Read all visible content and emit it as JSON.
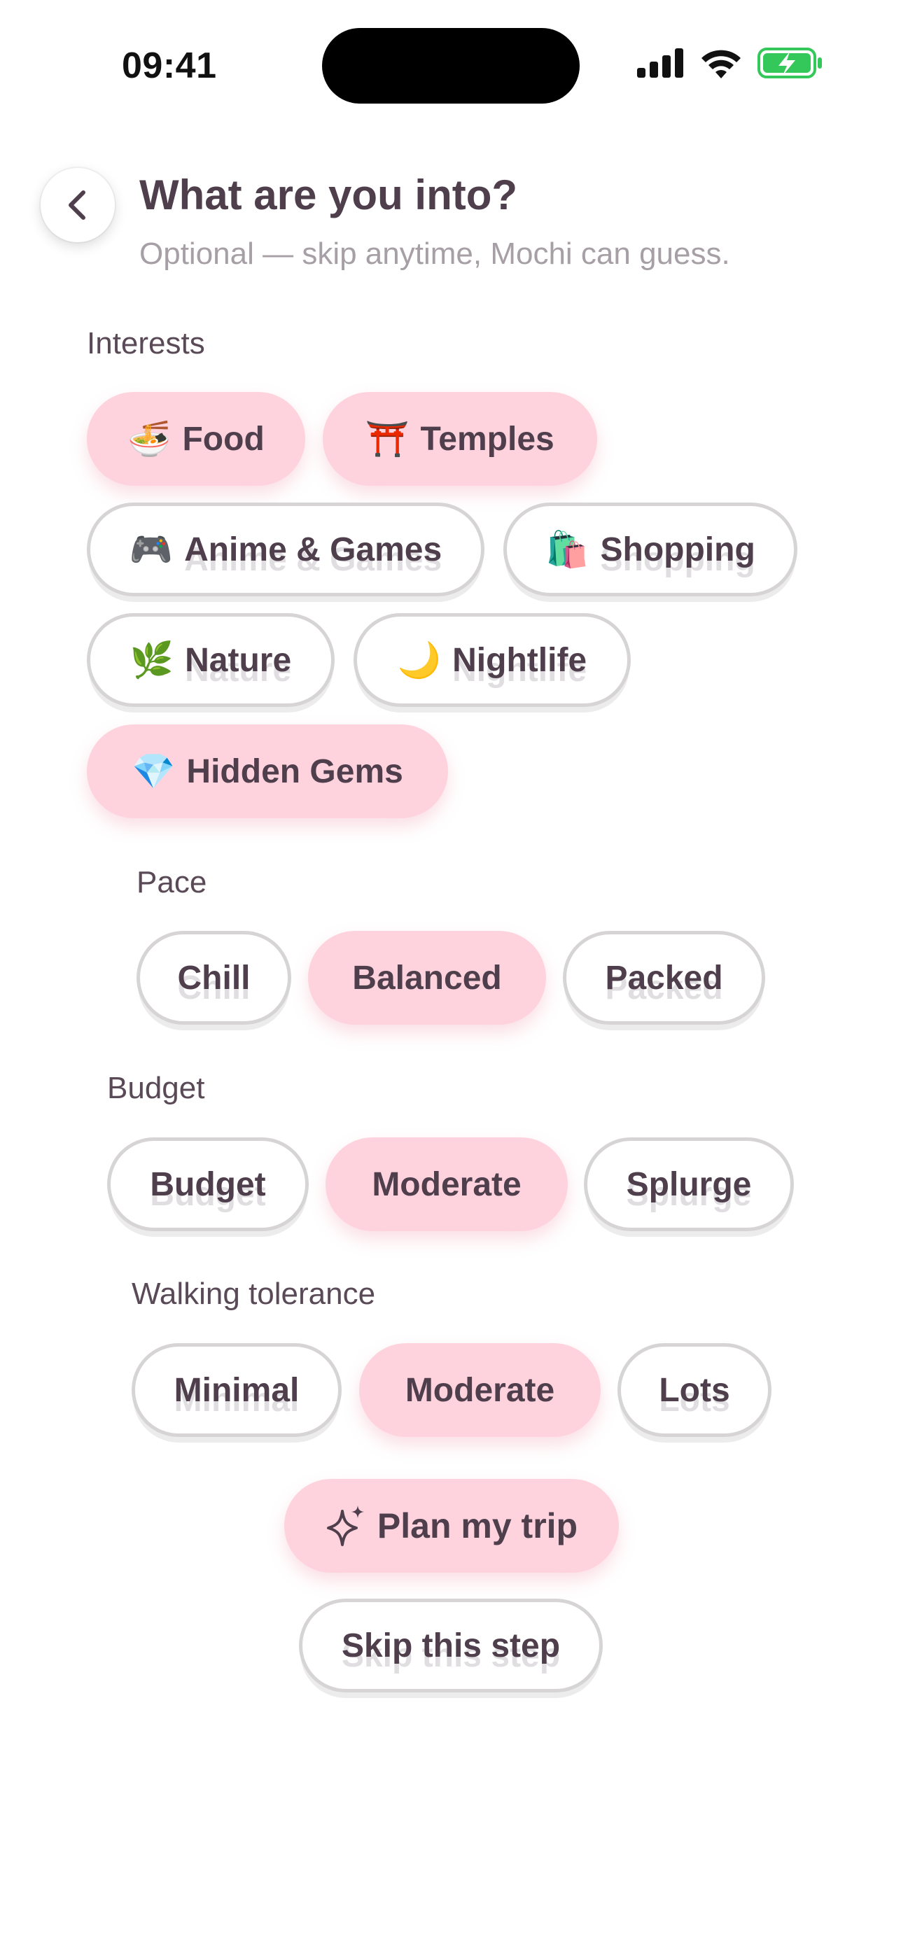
{
  "status": {
    "time": "09:41"
  },
  "header": {
    "title": "What are you into?",
    "subtitle": "Optional — skip anytime, Mochi can guess."
  },
  "interests": {
    "label": "Interests",
    "items": [
      {
        "emoji": "🍜",
        "label": "Food",
        "selected": true
      },
      {
        "emoji": "⛩️",
        "label": "Temples",
        "selected": true
      },
      {
        "emoji": "🎮",
        "label": "Anime & Games",
        "selected": false
      },
      {
        "emoji": "🛍️",
        "label": "Shopping",
        "selected": false
      },
      {
        "emoji": "🌿",
        "label": "Nature",
        "selected": false
      },
      {
        "emoji": "🌙",
        "label": "Nightlife",
        "selected": false
      },
      {
        "emoji": "💎",
        "label": "Hidden Gems",
        "selected": true
      }
    ]
  },
  "pace": {
    "label": "Pace",
    "options": [
      {
        "label": "Chill",
        "selected": false
      },
      {
        "label": "Balanced",
        "selected": true
      },
      {
        "label": "Packed",
        "selected": false
      }
    ]
  },
  "budget": {
    "label": "Budget",
    "options": [
      {
        "label": "Budget",
        "selected": false
      },
      {
        "label": "Moderate",
        "selected": true
      },
      {
        "label": "Splurge",
        "selected": false
      }
    ]
  },
  "walking": {
    "label": "Walking tolerance",
    "options": [
      {
        "label": "Minimal",
        "selected": false
      },
      {
        "label": "Moderate",
        "selected": true
      },
      {
        "label": "Lots",
        "selected": false
      }
    ]
  },
  "actions": {
    "plan_label": "Plan my trip",
    "skip_label": "Skip this step"
  },
  "colors": {
    "selected_chip": "#ffd3dd",
    "text": "#4f3f4c",
    "battery": "#34c759"
  }
}
